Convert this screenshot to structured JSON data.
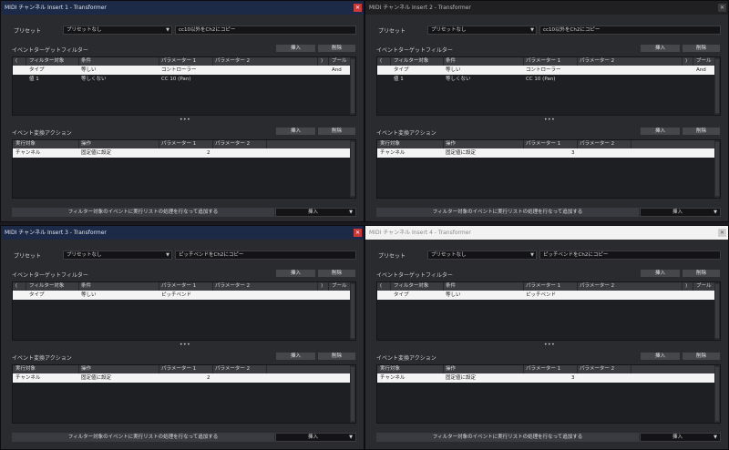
{
  "common": {
    "preset_label": "プリセット",
    "preset_value": "プリセットなし",
    "filter_section": "イベントターゲットフィルター",
    "action_section": "イベント変換アクション",
    "insert": "挿入",
    "delete": "削除",
    "bottom_text": "フィルター対象のイベントに実行リストの処理を行なって追加する",
    "bottom_mode": "挿入",
    "filter_headers": [
      "(",
      "フィルター対象",
      "条件",
      "パラメーター 1",
      "パラメーター 2",
      ")",
      "ブール"
    ],
    "action_headers": [
      "実行対象",
      "操作",
      "パラメーター 1",
      "パラメーター 2"
    ]
  },
  "windows": [
    {
      "title": "MIDI チャンネル Insert 1 - Transformer",
      "name_field": "cc10以外をCh2にコピー",
      "filter_rows": [
        {
          "target": "タイプ",
          "cond": "等しい",
          "p1": "コントローラー",
          "bool": "And"
        },
        {
          "target": "値 1",
          "cond": "等しくない",
          "p1": "CC 10 (Pan)",
          "bool": ""
        }
      ],
      "action_rows": [
        {
          "target": "チャンネル",
          "op": "固定値に設定",
          "p1": "2"
        }
      ]
    },
    {
      "title": "MIDI チャンネル Insert 2 - Transformer",
      "name_field": "cc10以外をCh2にコピー",
      "filter_rows": [
        {
          "target": "タイプ",
          "cond": "等しい",
          "p1": "コントローラー",
          "bool": "And"
        },
        {
          "target": "値 1",
          "cond": "等しくない",
          "p1": "CC 10 (Pan)",
          "bool": ""
        }
      ],
      "action_rows": [
        {
          "target": "チャンネル",
          "op": "固定値に設定",
          "p1": "3"
        }
      ]
    },
    {
      "title": "MIDI チャンネル Insert 3 - Transformer",
      "name_field": "ピッチベンドをCh2にコピー",
      "filter_rows": [
        {
          "target": "タイプ",
          "cond": "等しい",
          "p1": "ピッチベンド",
          "bool": ""
        }
      ],
      "action_rows": [
        {
          "target": "チャンネル",
          "op": "固定値に設定",
          "p1": "2"
        }
      ]
    },
    {
      "title": "MIDI チャンネル Insert 4 - Transformer",
      "name_field": "ピッチベンドをCh2にコピー",
      "filter_rows": [
        {
          "target": "タイプ",
          "cond": "等しい",
          "p1": "ピッチベンド",
          "bool": ""
        }
      ],
      "action_rows": [
        {
          "target": "チャンネル",
          "op": "固定値に設定",
          "p1": "3"
        }
      ]
    }
  ]
}
